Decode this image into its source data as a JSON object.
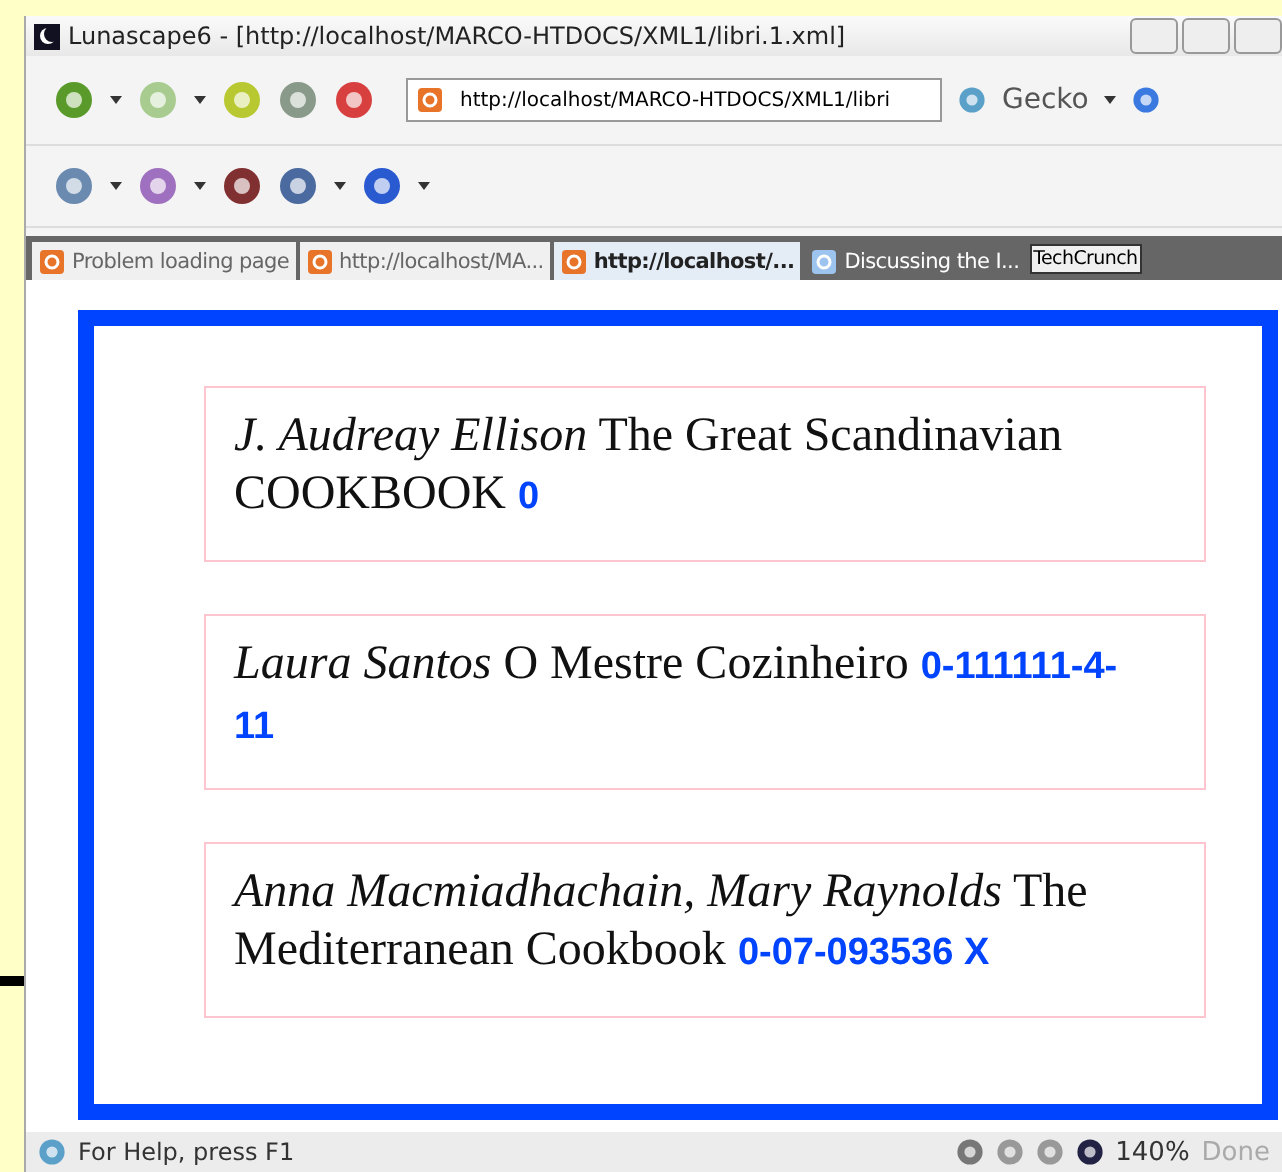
{
  "window": {
    "title": "Lunascape6 - [http://localhost/MARCO-HTDOCS/XML1/libri.1.xml]"
  },
  "address": {
    "value": "http://localhost/MARCO-HTDOCS/XML1/libri"
  },
  "engine": {
    "label": "Gecko"
  },
  "tabs": [
    {
      "label": "Problem loading page",
      "selected": false,
      "kind": "page"
    },
    {
      "label": "http://localhost/MA...",
      "selected": false,
      "kind": "page"
    },
    {
      "label": "http://localhost/...",
      "selected": true,
      "kind": "page"
    },
    {
      "label": "Discussing the I...",
      "selected": false,
      "kind": "new"
    },
    {
      "label": "TechCrunch",
      "selected": false,
      "kind": "tag"
    }
  ],
  "books": [
    {
      "author": "J. Audreay Ellison",
      "title": "The Great Scandinavian COOKBOOK",
      "isbn": "0"
    },
    {
      "author": "Laura Santos",
      "title": "O Mestre Cozinheiro",
      "isbn": "0-111111-4-11"
    },
    {
      "author": "Anna Macmiadhachain, Mary Raynolds",
      "title": "The Mediterranean Cookbook",
      "isbn": "0-07-093536 X"
    }
  ],
  "status_bar": {
    "help": "For Help, press F1",
    "zoom": "140%",
    "state": "Done"
  }
}
